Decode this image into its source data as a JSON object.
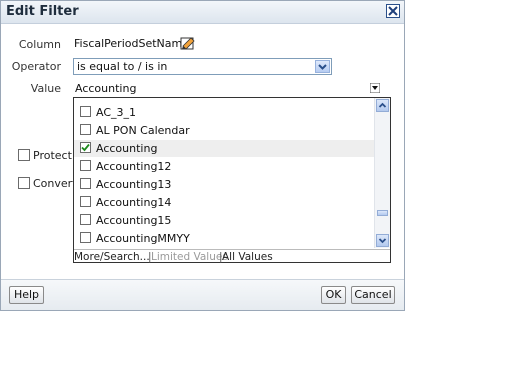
{
  "dialog": {
    "title": "Edit Filter",
    "close_icon": "close-icon"
  },
  "form": {
    "column_label": "Column",
    "column_value": "FiscalPeriodSetName",
    "operator_label": "Operator",
    "operator_value": "is equal to / is in",
    "value_label": "Value",
    "value_text": "Accounting"
  },
  "dropdown": {
    "items": [
      {
        "label": "AC_3_1",
        "checked": false
      },
      {
        "label": "AL PON Calendar",
        "checked": false
      },
      {
        "label": "Accounting",
        "checked": true
      },
      {
        "label": "Accounting12",
        "checked": false
      },
      {
        "label": "Accounting13",
        "checked": false
      },
      {
        "label": "Accounting14",
        "checked": false
      },
      {
        "label": "Accounting15",
        "checked": false
      },
      {
        "label": "AccountingMMYY",
        "checked": false
      }
    ],
    "footer": {
      "more_search": "More/Search...",
      "separator": "|",
      "limited_values": "Limited Values",
      "all_values": "All Values"
    }
  },
  "options": {
    "protect_label": "Protect",
    "convert_label": "Convert"
  },
  "buttons": {
    "help": "Help",
    "ok": "OK",
    "cancel": "Cancel"
  },
  "colors": {
    "accent": "#2a4f8a",
    "selected_row": "#eeeeee"
  }
}
